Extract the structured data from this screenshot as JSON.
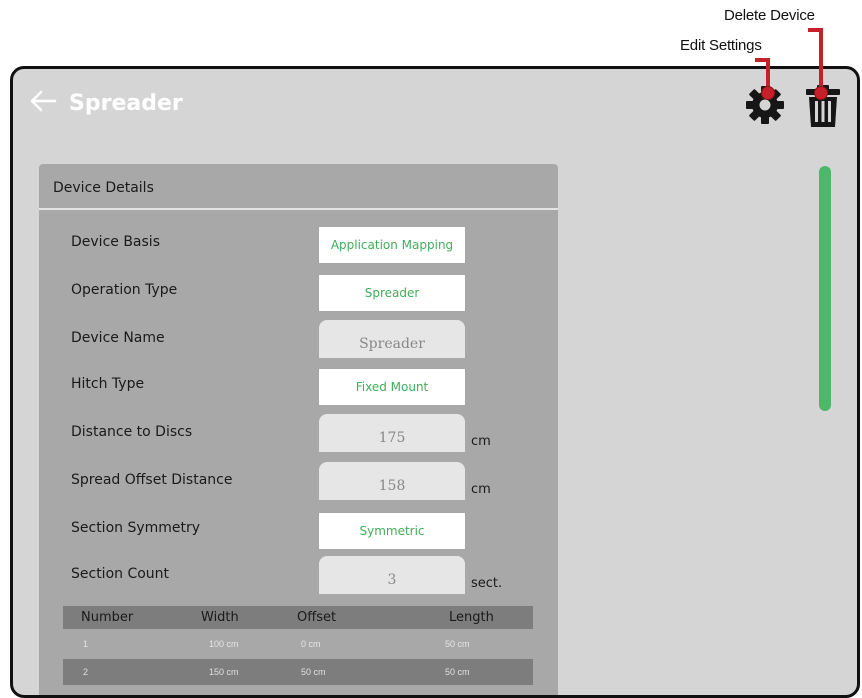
{
  "callouts": {
    "delete_device": "Delete Device",
    "edit_settings": "Edit Settings"
  },
  "header": {
    "title": "Spreader",
    "back_icon": "arrow-left-icon",
    "gear_icon": "gear-icon",
    "trash_icon": "trash-icon"
  },
  "panel": {
    "title": "Device Details",
    "rows": [
      {
        "label": "Device Basis",
        "value": "Application Mapping",
        "kind": "select"
      },
      {
        "label": "Operation Type",
        "value": "Spreader",
        "kind": "select"
      },
      {
        "label": "Device Name",
        "value": "Spreader",
        "kind": "input"
      },
      {
        "label": "Hitch Type",
        "value": "Fixed Mount",
        "kind": "select"
      },
      {
        "label": "Distance to Discs",
        "value": "175",
        "kind": "input",
        "unit": "cm"
      },
      {
        "label": "Spread Offset Distance",
        "value": "158",
        "kind": "input",
        "unit": "cm"
      },
      {
        "label": "Section Symmetry",
        "value": "Symmetric",
        "kind": "select"
      },
      {
        "label": "Section Count",
        "value": "3",
        "kind": "input",
        "unit": "sect."
      }
    ]
  },
  "table": {
    "headers": [
      "Number",
      "Width",
      "Offset",
      "Length"
    ],
    "rows": [
      [
        "1",
        "100 cm",
        "0 cm",
        "50 cm"
      ],
      [
        "2",
        "150 cm",
        "50 cm",
        "50 cm"
      ]
    ]
  },
  "colors": {
    "accent_green": "#3fae5a",
    "scrollbar_green": "#4db86a",
    "callout_red": "#c8202a"
  }
}
